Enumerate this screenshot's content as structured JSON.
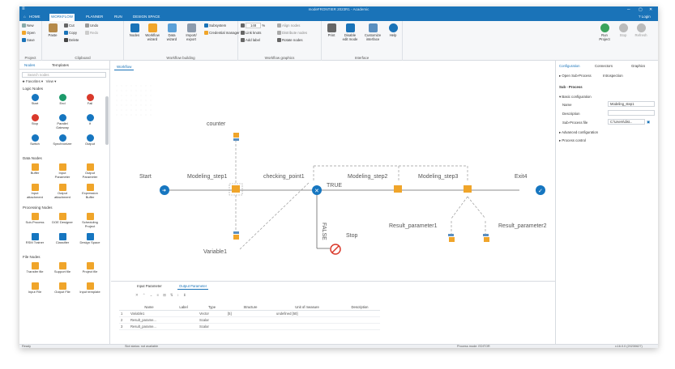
{
  "titlebar": {
    "title": "modeFRONTIER 2023R1 - Academic",
    "help": "? Login"
  },
  "menubar": {
    "items": [
      "HOME",
      "WORKFLOW",
      "PLANNER",
      "RUN",
      "DESIGN SPACE"
    ],
    "active": 1
  },
  "ribbon": {
    "project": {
      "label": "Project",
      "new": "New",
      "open": "Open",
      "save": "Save"
    },
    "clipboard": {
      "label": "Clipboard",
      "paste": "Paste",
      "cut": "Cut",
      "copy": "Copy",
      "delete": "Delete",
      "undo": "Undo",
      "redo": "Redo"
    },
    "workflow_building": {
      "label": "Workflow building",
      "nodes": "Nodes",
      "workflow_wizard": "Workflow wizard",
      "data_wizard": "Data wizard",
      "import_export": "Import/ export",
      "subsystem": "Subsystem",
      "credential_manager": "Credential manager"
    },
    "workflow_graphics": {
      "label": "Workflow graphics",
      "zoom": "148",
      "link_knots": "Link knots",
      "add_label": "Add label",
      "align_nodes": "Align nodes",
      "distribute_nodes": "Distribute nodes",
      "rotate_nodes": "Rotate nodes"
    },
    "interface": {
      "label": "Interface",
      "print": "Print",
      "disable_edit_mode": "Disable edit mode",
      "customize_interface": "Customize interface",
      "help": "Help"
    },
    "run": {
      "run_project": "Run Project",
      "stop": "Stop",
      "refresh": "Refresh"
    }
  },
  "leftpanel": {
    "tabs": [
      "Nodes",
      "Templates"
    ],
    "search_placeholder": "Search nodes",
    "favorites": "Favorites",
    "view": "View",
    "sections": [
      {
        "title": "Logic Nodes",
        "items": [
          "Start",
          "End",
          "Fail",
          "Stop",
          "Parallel Gateway",
          "If",
          "Switch",
          "Synchronizer",
          "Output"
        ]
      },
      {
        "title": "Data Nodes",
        "items": [
          "Buffer",
          "Input Parameter",
          "Output Parameter",
          "Input attachment",
          "Output attachment",
          "Expression Buffer"
        ]
      },
      {
        "title": "Processing Nodes",
        "items": [
          "Sub-Process",
          "DOE Designer",
          "Scheduling Project",
          "RSM Trainer",
          "Classifier",
          "Design Space"
        ]
      },
      {
        "title": "File Nodes",
        "items": [
          "Transfer file",
          "Support file",
          "Project file",
          "Input File",
          "Output File",
          "Input template"
        ]
      }
    ]
  },
  "workarea": {
    "tab": "Workflow",
    "labels": {
      "counter": "counter",
      "start": "Start",
      "modeling1": "Modeling_step1",
      "checking": "checking_point1",
      "true": "TRUE",
      "false": "FALSE",
      "modeling2": "Modeling_step2",
      "modeling3": "Modeling_step3",
      "exit": "Exit4",
      "stop": "Stop",
      "variable": "Variable1",
      "result1": "Result_parameter1",
      "result2": "Result_parameter2",
      "badge": "128"
    }
  },
  "rightpanel": {
    "tabs": [
      "Configuration",
      "Connectors",
      "Graphics"
    ],
    "open_sub": "Open Sub-Process",
    "introspection": "Introspection",
    "node_title": "Sub - Process",
    "basic": "Basic configuration",
    "name_label": "Name",
    "name_value": "Modeling_step1",
    "desc_label": "Description",
    "desc_value": "",
    "file_label": "Sub-Process file",
    "file_value": "C:\\Users\\dist...",
    "advanced": "Advanced configuration",
    "process": "Process control"
  },
  "bottompanel": {
    "tabs": [
      "Input Parameter",
      "Output Parameter"
    ],
    "columns": [
      "Name",
      "Label",
      "Type",
      "Structure",
      "Unit of measure",
      "Description"
    ],
    "rows": [
      {
        "n": "1",
        "name": "Variable1",
        "label": "",
        "type": "Vector",
        "structure": "[5]",
        "unit": "undefined [50]",
        "desc": ""
      },
      {
        "n": "2",
        "name": "Result_parame...",
        "label": "",
        "type": "Scalar",
        "structure": "",
        "unit": "",
        "desc": ""
      },
      {
        "n": "3",
        "name": "Result_parame...",
        "label": "",
        "type": "Scalar",
        "structure": "",
        "unit": "",
        "desc": ""
      }
    ]
  },
  "statusbar": {
    "left": "Ready",
    "mid": "Slot status: not available",
    "right": "Process mode: EDITOR",
    "version": "v.16.0.0 (20230627)"
  },
  "colors": {
    "accent": "#1a73b8",
    "node_blue": "#1676c0",
    "node_green": "#1c9a6a",
    "node_red": "#d9392b",
    "folder": "#f0a52a"
  }
}
